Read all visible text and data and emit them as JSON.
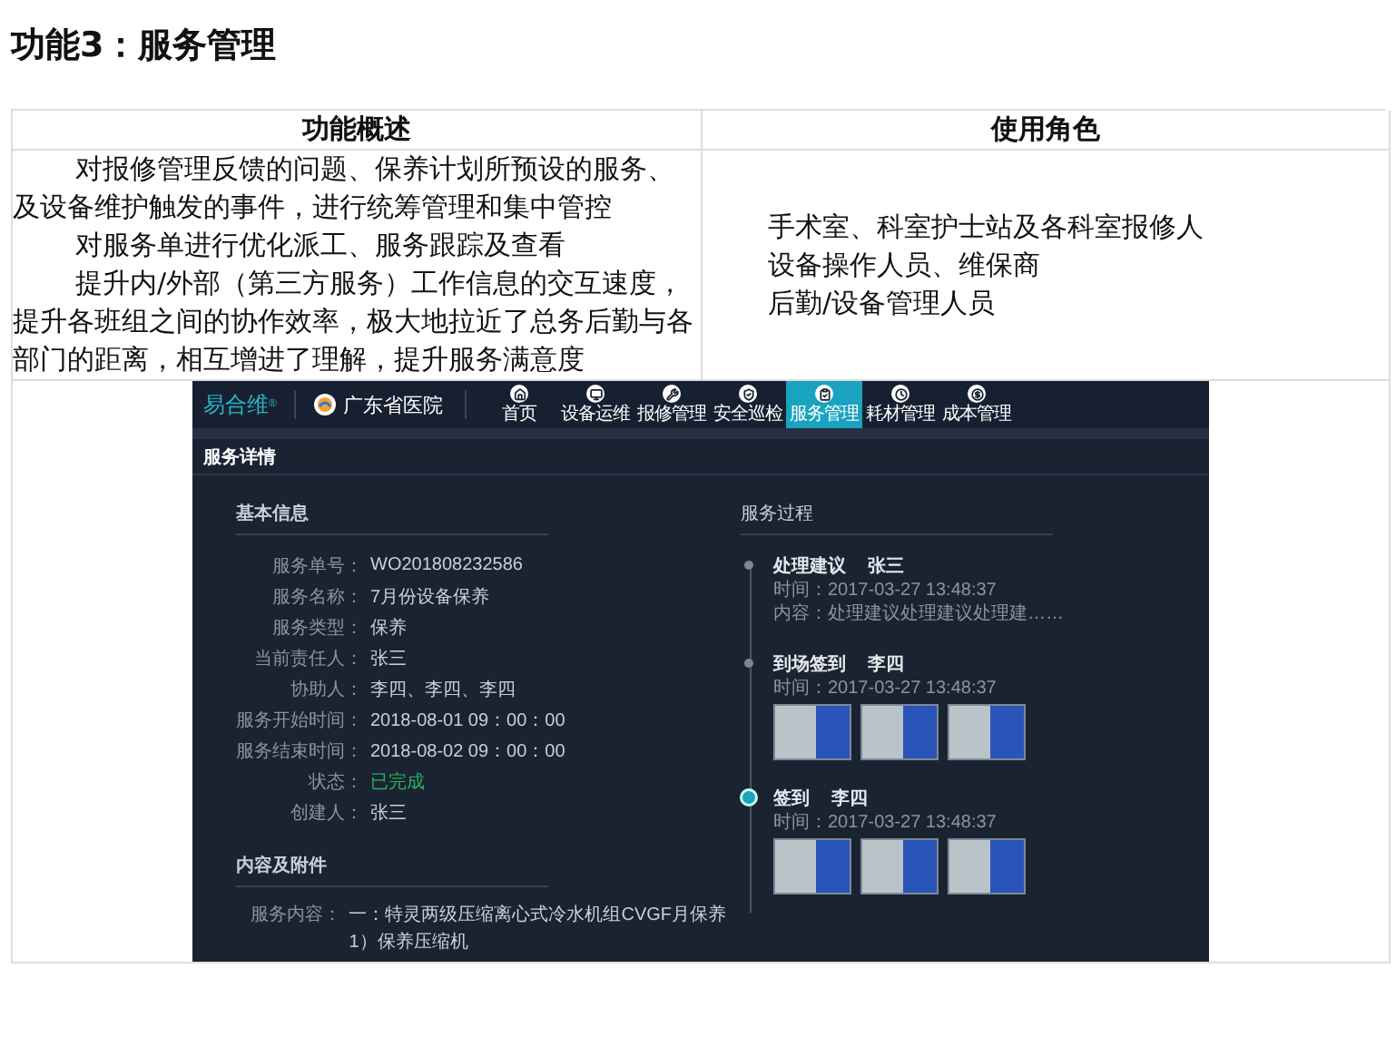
{
  "heading": "功能3：服务管理",
  "table": {
    "columns": [
      "功能概述",
      "使用角色"
    ],
    "overview": [
      "对报修管理反馈的问题、保养计划所预设的服务、及设备维护触发的事件，进行统筹管理和集中管控",
      "对服务单进行优化派工、服务跟踪及查看",
      "提升内/外部（第三方服务）工作信息的交互速度，提升各班组之间的协作效率，极大地拉近了总务后勤与各部门的距离，相互增进了理解，提升服务满意度"
    ],
    "roles": [
      "手术室、科室护士站及各科室报修人",
      "设备操作人员、维保商",
      "后勤/设备管理人员"
    ]
  },
  "app": {
    "logo": "易合维",
    "logo_mark": "®",
    "hospital": "广东省医院",
    "nav": [
      {
        "label": "首页",
        "selected": false
      },
      {
        "label": "设备运维",
        "selected": false
      },
      {
        "label": "报修管理",
        "selected": false
      },
      {
        "label": "安全巡检",
        "selected": false
      },
      {
        "label": "服务管理",
        "selected": true
      },
      {
        "label": "耗材管理",
        "selected": false
      },
      {
        "label": "成本管理",
        "selected": false
      }
    ],
    "page_title": "服务详情",
    "basic": {
      "title": "基本信息",
      "fields": [
        {
          "kind": "text",
          "label": "服务单号：",
          "value": "WO201808232586"
        },
        {
          "kind": "text",
          "label": "服务名称：",
          "value": "7月份设备保养"
        },
        {
          "kind": "text",
          "label": "服务类型：",
          "value": "保养"
        },
        {
          "kind": "text",
          "label": "当前责任人：",
          "value": "张三"
        },
        {
          "kind": "text",
          "label": "协助人：",
          "value": "李四、李四、李四"
        },
        {
          "kind": "text",
          "label": "服务开始时间：",
          "value": "2018-08-01  09：00：00"
        },
        {
          "kind": "text",
          "label": "服务结束时间：",
          "value": "2018-08-02  09：00：00"
        },
        {
          "kind": "status",
          "label": "状态：",
          "value": "已完成"
        },
        {
          "kind": "text",
          "label": "创建人：",
          "value": "张三"
        }
      ]
    },
    "attachments": {
      "title": "内容及附件",
      "label": "服务内容：",
      "lines": [
        "一：特灵两级压缩离心式冷水机组CVGF月保养",
        "1）保养压缩机"
      ]
    },
    "process": {
      "title": "服务过程",
      "steps": [
        {
          "title": "处理建议",
          "person": "张三",
          "time": "时间：2017-03-27 13:48:37",
          "content": "内容：处理建议处理建议处理建……",
          "has_photos": false,
          "current": false
        },
        {
          "title": "到场签到",
          "person": "李四",
          "time": "时间：2017-03-27 13:48:37",
          "has_photos": true,
          "current": false
        },
        {
          "title": "签到",
          "person": "李四",
          "time": "时间：2017-03-27 13:48:37",
          "has_photos": true,
          "current": true
        }
      ]
    }
  }
}
